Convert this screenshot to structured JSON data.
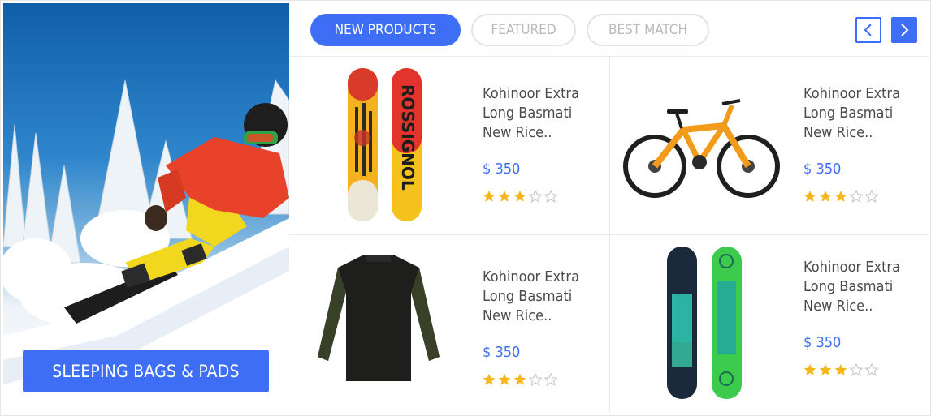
{
  "banner": {
    "button_label": "SLEEPING BAGS & PADS",
    "image": "snowboarder-on-snowy-slope"
  },
  "tabs": [
    {
      "label": "NEW PRODUCTS",
      "active": true
    },
    {
      "label": "FEATURED",
      "active": false
    },
    {
      "label": "BEST MATCH",
      "active": false
    }
  ],
  "nav": {
    "prev_icon": "chevron-left-icon",
    "next_icon": "chevron-right-icon"
  },
  "colors": {
    "accent": "#3d6ef5",
    "star_filled": "#f5b61d",
    "star_empty": "#c9c9c9",
    "title_text": "#4b4b4b"
  },
  "products": [
    {
      "name_lines": [
        "Kohinoor Extra",
        "Long Basmati",
        "New Rice.."
      ],
      "price": "$ 350",
      "rating": 3,
      "max_rating": 5,
      "image": "rossignol-snowboards"
    },
    {
      "name_lines": [
        "Kohinoor Extra",
        "Long Basmati",
        "New Rice.."
      ],
      "price": "$ 350",
      "rating": 3,
      "max_rating": 5,
      "image": "orange-mountain-bike"
    },
    {
      "name_lines": [
        "Kohinoor Extra",
        "Long Basmati",
        "New Rice.."
      ],
      "price": "$ 350",
      "rating": 3,
      "max_rating": 5,
      "image": "black-wetsuit"
    },
    {
      "name_lines": [
        "Kohinoor Extra",
        "Long Basmati",
        "New Rice.."
      ],
      "price": "$ 350",
      "rating": 3,
      "max_rating": 5,
      "image": "green-snowboards"
    }
  ]
}
